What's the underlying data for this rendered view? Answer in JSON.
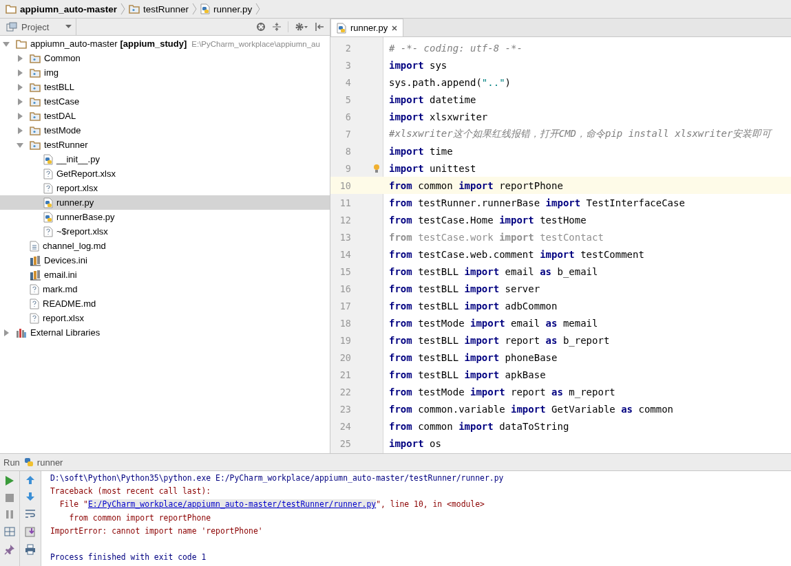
{
  "breadcrumbs": [
    {
      "kind": "project",
      "label": "appiumn_auto-master"
    },
    {
      "kind": "package",
      "label": "testRunner"
    },
    {
      "kind": "python",
      "label": "runner.py"
    }
  ],
  "project_panel": {
    "title": "Project",
    "tree": {
      "name": "appiumn_auto-master",
      "module": "[appium_study]",
      "path": "E:\\PyCharm_workplace\\appiumn_au",
      "expanded": true,
      "children": [
        {
          "name": "Common",
          "kind": "package",
          "expanded": false,
          "selected": false
        },
        {
          "name": "img",
          "kind": "package",
          "expanded": false,
          "selected": false
        },
        {
          "name": "testBLL",
          "kind": "package",
          "expanded": false,
          "selected": false
        },
        {
          "name": "testCase",
          "kind": "package",
          "expanded": false,
          "selected": false
        },
        {
          "name": "testDAL",
          "kind": "package",
          "expanded": false,
          "selected": false
        },
        {
          "name": "testMode",
          "kind": "package",
          "expanded": false,
          "selected": false
        },
        {
          "name": "testRunner",
          "kind": "package",
          "expanded": true,
          "selected": false,
          "children": [
            {
              "name": "__init__.py",
              "kind": "python",
              "selected": false
            },
            {
              "name": "GetReport.xlsx",
              "kind": "unknown",
              "selected": false
            },
            {
              "name": "report.xlsx",
              "kind": "unknown",
              "selected": false
            },
            {
              "name": "runner.py",
              "kind": "python",
              "selected": true
            },
            {
              "name": "runnerBase.py",
              "kind": "python",
              "selected": false
            },
            {
              "name": "~$report.xlsx",
              "kind": "unknown",
              "selected": false
            }
          ]
        },
        {
          "name": "channel_log.md",
          "kind": "text",
          "selected": false
        },
        {
          "name": "Devices.ini",
          "kind": "config",
          "selected": false
        },
        {
          "name": "email.ini",
          "kind": "config",
          "selected": false
        },
        {
          "name": "mark.md",
          "kind": "unknown",
          "selected": false
        },
        {
          "name": "README.md",
          "kind": "unknown",
          "selected": false
        },
        {
          "name": "report.xlsx",
          "kind": "unknown",
          "selected": false
        }
      ]
    },
    "extra": [
      {
        "name": "External Libraries",
        "kind": "libraries",
        "expanded": false,
        "selected": false
      }
    ]
  },
  "editor": {
    "tabs": [
      {
        "label": "runner.py",
        "selected": true
      }
    ],
    "lines": [
      {
        "number": "2",
        "current": false,
        "unused": false,
        "tokens": [
          {
            "kind": "comment",
            "text": "# -*- coding: utf-8 -*-"
          }
        ]
      },
      {
        "number": "3",
        "current": false,
        "unused": false,
        "tokens": [
          {
            "kind": "kw",
            "text": "import"
          },
          {
            "kind": "plain",
            "text": " sys"
          }
        ]
      },
      {
        "number": "4",
        "current": false,
        "unused": false,
        "tokens": [
          {
            "kind": "plain",
            "text": "sys.path.append("
          },
          {
            "kind": "str",
            "text": "\"..\""
          },
          {
            "kind": "plain",
            "text": ")"
          }
        ]
      },
      {
        "number": "5",
        "current": false,
        "unused": false,
        "tokens": [
          {
            "kind": "kw",
            "text": "import"
          },
          {
            "kind": "plain",
            "text": " datetime"
          }
        ]
      },
      {
        "number": "6",
        "current": false,
        "unused": false,
        "tokens": [
          {
            "kind": "kw",
            "text": "import"
          },
          {
            "kind": "plain",
            "text": " xlsxwriter"
          }
        ]
      },
      {
        "number": "7",
        "current": false,
        "unused": false,
        "tokens": [
          {
            "kind": "comment",
            "text": "#xlsxwriter这个如果红线报错，打开CMD，命令pip install xlsxwriter安装即可"
          }
        ]
      },
      {
        "number": "8",
        "current": false,
        "unused": false,
        "tokens": [
          {
            "kind": "kw",
            "text": "import"
          },
          {
            "kind": "plain",
            "text": " time"
          }
        ]
      },
      {
        "number": "9",
        "current": false,
        "unused": false,
        "bulb": true,
        "tokens": [
          {
            "kind": "kw",
            "text": "import"
          },
          {
            "kind": "plain",
            "text": " unittest"
          }
        ]
      },
      {
        "number": "10",
        "current": true,
        "unused": false,
        "tokens": [
          {
            "kind": "kw",
            "text": "from"
          },
          {
            "kind": "plain",
            "text": " common "
          },
          {
            "kind": "kw",
            "text": "import"
          },
          {
            "kind": "plain",
            "text": " reportPhone"
          }
        ]
      },
      {
        "number": "11",
        "current": false,
        "unused": false,
        "tokens": [
          {
            "kind": "kw",
            "text": "from"
          },
          {
            "kind": "plain",
            "text": " testRunner.runnerBase "
          },
          {
            "kind": "kw",
            "text": "import"
          },
          {
            "kind": "plain",
            "text": " TestInterfaceCase"
          }
        ]
      },
      {
        "number": "12",
        "current": false,
        "unused": false,
        "tokens": [
          {
            "kind": "kw",
            "text": "from"
          },
          {
            "kind": "plain",
            "text": " testCase.Home "
          },
          {
            "kind": "kw",
            "text": "import"
          },
          {
            "kind": "plain",
            "text": " testHome"
          }
        ]
      },
      {
        "number": "13",
        "current": false,
        "unused": true,
        "tokens": [
          {
            "kind": "kw",
            "text": "from"
          },
          {
            "kind": "plain",
            "text": " testCase.work "
          },
          {
            "kind": "kw",
            "text": "import"
          },
          {
            "kind": "plain",
            "text": " testContact"
          }
        ]
      },
      {
        "number": "14",
        "current": false,
        "unused": false,
        "tokens": [
          {
            "kind": "kw",
            "text": "from"
          },
          {
            "kind": "plain",
            "text": " testCase.web.comment "
          },
          {
            "kind": "kw",
            "text": "import"
          },
          {
            "kind": "plain",
            "text": " testComment"
          }
        ]
      },
      {
        "number": "15",
        "current": false,
        "unused": false,
        "tokens": [
          {
            "kind": "kw",
            "text": "from"
          },
          {
            "kind": "plain",
            "text": " testBLL "
          },
          {
            "kind": "kw",
            "text": "import"
          },
          {
            "kind": "plain",
            "text": " email "
          },
          {
            "kind": "kw",
            "text": "as"
          },
          {
            "kind": "plain",
            "text": " b_email"
          }
        ]
      },
      {
        "number": "16",
        "current": false,
        "unused": false,
        "tokens": [
          {
            "kind": "kw",
            "text": "from"
          },
          {
            "kind": "plain",
            "text": " testBLL "
          },
          {
            "kind": "kw",
            "text": "import"
          },
          {
            "kind": "plain",
            "text": " server"
          }
        ]
      },
      {
        "number": "17",
        "current": false,
        "unused": false,
        "tokens": [
          {
            "kind": "kw",
            "text": "from"
          },
          {
            "kind": "plain",
            "text": " testBLL "
          },
          {
            "kind": "kw",
            "text": "import"
          },
          {
            "kind": "plain",
            "text": " adbCommon"
          }
        ]
      },
      {
        "number": "18",
        "current": false,
        "unused": false,
        "tokens": [
          {
            "kind": "kw",
            "text": "from"
          },
          {
            "kind": "plain",
            "text": " testMode "
          },
          {
            "kind": "kw",
            "text": "import"
          },
          {
            "kind": "plain",
            "text": " email "
          },
          {
            "kind": "kw",
            "text": "as"
          },
          {
            "kind": "plain",
            "text": " memail"
          }
        ]
      },
      {
        "number": "19",
        "current": false,
        "unused": false,
        "tokens": [
          {
            "kind": "kw",
            "text": "from"
          },
          {
            "kind": "plain",
            "text": " testBLL "
          },
          {
            "kind": "kw",
            "text": "import"
          },
          {
            "kind": "plain",
            "text": " report "
          },
          {
            "kind": "kw",
            "text": "as"
          },
          {
            "kind": "plain",
            "text": " b_report"
          }
        ]
      },
      {
        "number": "20",
        "current": false,
        "unused": false,
        "tokens": [
          {
            "kind": "kw",
            "text": "from"
          },
          {
            "kind": "plain",
            "text": " testBLL "
          },
          {
            "kind": "kw",
            "text": "import"
          },
          {
            "kind": "plain",
            "text": " phoneBase"
          }
        ]
      },
      {
        "number": "21",
        "current": false,
        "unused": false,
        "tokens": [
          {
            "kind": "kw",
            "text": "from"
          },
          {
            "kind": "plain",
            "text": " testBLL "
          },
          {
            "kind": "kw",
            "text": "import"
          },
          {
            "kind": "plain",
            "text": " apkBase"
          }
        ]
      },
      {
        "number": "22",
        "current": false,
        "unused": false,
        "tokens": [
          {
            "kind": "kw",
            "text": "from"
          },
          {
            "kind": "plain",
            "text": " testMode "
          },
          {
            "kind": "kw",
            "text": "import"
          },
          {
            "kind": "plain",
            "text": " report "
          },
          {
            "kind": "kw",
            "text": "as"
          },
          {
            "kind": "plain",
            "text": " m_report"
          }
        ]
      },
      {
        "number": "23",
        "current": false,
        "unused": false,
        "tokens": [
          {
            "kind": "kw",
            "text": "from"
          },
          {
            "kind": "plain",
            "text": " common.variable "
          },
          {
            "kind": "kw",
            "text": "import"
          },
          {
            "kind": "plain",
            "text": " GetVariable "
          },
          {
            "kind": "kw",
            "text": "as"
          },
          {
            "kind": "plain",
            "text": " common"
          }
        ]
      },
      {
        "number": "24",
        "current": false,
        "unused": false,
        "tokens": [
          {
            "kind": "kw",
            "text": "from"
          },
          {
            "kind": "plain",
            "text": " common "
          },
          {
            "kind": "kw",
            "text": "import"
          },
          {
            "kind": "plain",
            "text": " dataToString"
          }
        ]
      },
      {
        "number": "25",
        "current": false,
        "unused": false,
        "tokens": [
          {
            "kind": "kw",
            "text": "import"
          },
          {
            "kind": "plain",
            "text": " os"
          }
        ]
      }
    ]
  },
  "run_panel": {
    "title": "Run",
    "config": "runner",
    "console": [
      {
        "kind": "info",
        "segments": [
          {
            "link": false,
            "text": "D:\\soft\\Python\\Python35\\python.exe E:/PyCharm_workplace/appiumn_auto-master/testRunner/runner.py"
          }
        ]
      },
      {
        "kind": "error",
        "segments": [
          {
            "link": false,
            "text": "Traceback (most recent call last):"
          }
        ]
      },
      {
        "kind": "error",
        "segments": [
          {
            "link": false,
            "text": "  File \""
          },
          {
            "link": true,
            "text": "E:/PyCharm_workplace/appiumn_auto-master/testRunner/runner.py"
          },
          {
            "link": false,
            "text": "\", line 10, in <module>"
          }
        ]
      },
      {
        "kind": "error",
        "segments": [
          {
            "link": false,
            "text": "    from common import reportPhone"
          }
        ]
      },
      {
        "kind": "error",
        "segments": [
          {
            "link": false,
            "text": "ImportError: cannot import name 'reportPhone'"
          }
        ]
      },
      {
        "kind": "blank"
      },
      {
        "kind": "info",
        "segments": [
          {
            "link": false,
            "text": "Process finished with exit code 1"
          }
        ]
      }
    ]
  }
}
